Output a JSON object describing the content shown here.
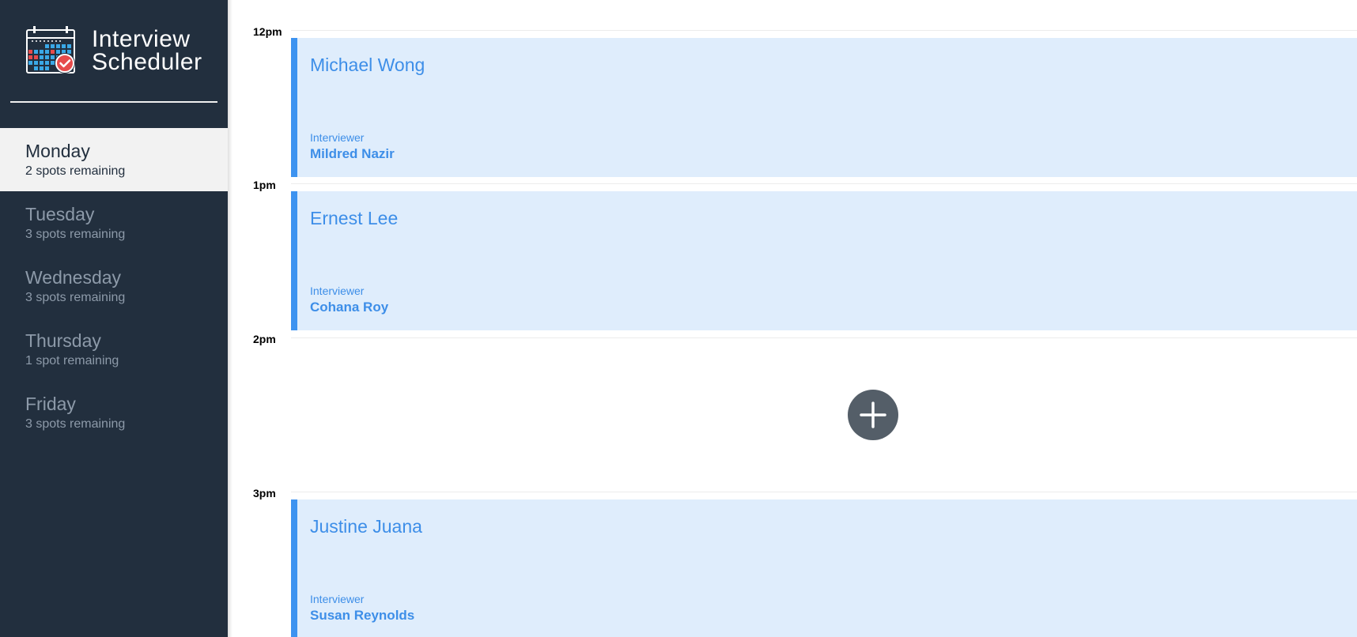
{
  "app": {
    "title_line1": "Interview",
    "title_line2": "Scheduler",
    "logo_icon": "calendar-check-icon"
  },
  "sidebar": {
    "days": [
      {
        "name": "Monday",
        "spots": "2 spots remaining",
        "selected": true
      },
      {
        "name": "Tuesday",
        "spots": "3 spots remaining",
        "selected": false
      },
      {
        "name": "Wednesday",
        "spots": "3 spots remaining",
        "selected": false
      },
      {
        "name": "Thursday",
        "spots": "1 spot remaining",
        "selected": false
      },
      {
        "name": "Friday",
        "spots": "3 spots remaining",
        "selected": false
      }
    ]
  },
  "schedule": {
    "slots": [
      {
        "time": "12pm",
        "student": "Michael Wong",
        "interviewer_label": "Interviewer",
        "interviewer": "Mildred Nazir"
      },
      {
        "time": "1pm",
        "student": "Ernest Lee",
        "interviewer_label": "Interviewer",
        "interviewer": "Cohana Roy"
      },
      {
        "time": "2pm",
        "empty": true,
        "add_icon": "plus-icon"
      },
      {
        "time": "3pm",
        "student": "Justine Juana",
        "interviewer_label": "Interviewer",
        "interviewer": "Susan Reynolds"
      }
    ]
  },
  "colors": {
    "sidebar_bg": "#222f3e",
    "selected_bg": "#f2f2f2",
    "appointment_bg": "#dfedfc",
    "appointment_accent": "#3d93f0",
    "appointment_text": "#3d8ee8",
    "add_button_bg": "#545e68"
  }
}
